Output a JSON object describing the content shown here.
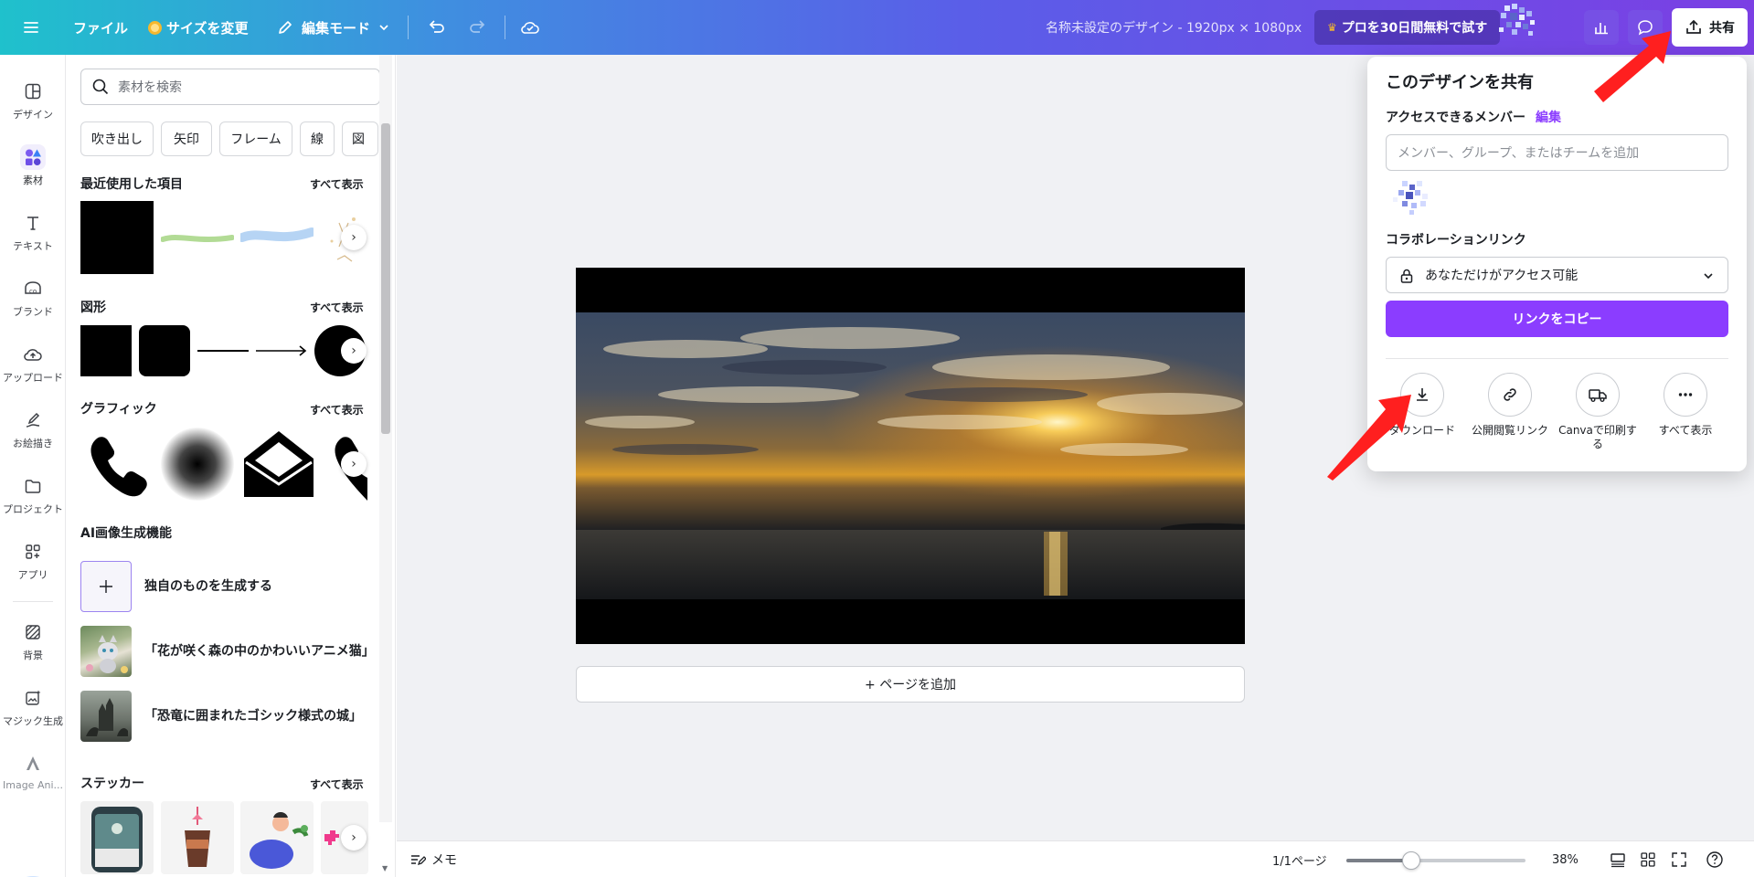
{
  "topbar": {
    "file": "ファイル",
    "resize": "サイズを変更",
    "edit_mode": "編集モード",
    "design_title": "名称未設定のデザイン - 1920px × 1080px",
    "pro_trial": "プロを30日間無料で試す",
    "share": "共有"
  },
  "rail": [
    {
      "label": "デザイン",
      "icon": "design-icon"
    },
    {
      "label": "素材",
      "icon": "elements-icon"
    },
    {
      "label": "テキスト",
      "icon": "text-icon"
    },
    {
      "label": "ブランド",
      "icon": "brand-icon"
    },
    {
      "label": "アップロード",
      "icon": "upload-icon"
    },
    {
      "label": "お絵描き",
      "icon": "draw-icon"
    },
    {
      "label": "プロジェクト",
      "icon": "folder-icon"
    },
    {
      "label": "アプリ",
      "icon": "apps-icon"
    },
    {
      "label": "背景",
      "icon": "background-icon"
    },
    {
      "label": "マジック生成",
      "icon": "magic-media-icon"
    },
    {
      "label": "Image Ani...",
      "icon": "image-animate-icon"
    }
  ],
  "panel": {
    "search_placeholder": "素材を検索",
    "chips": [
      "吹き出し",
      "矢印",
      "フレーム",
      "線",
      "図"
    ],
    "see_all": "すべて表示",
    "sections": {
      "recent": "最近使用した項目",
      "shapes": "図形",
      "graphics": "グラフィック",
      "ai": "AI画像生成機能",
      "stickers": "ステッカー"
    },
    "ai_items": [
      "独自のものを生成する",
      "「花が咲く森の中のかわいいアニメ猫」",
      "「恐竜に囲まれたゴシック様式の城」"
    ]
  },
  "canvas": {
    "add_page": "+ ページを追加"
  },
  "bottombar": {
    "notes": "メモ",
    "page_indicator": "1/1ページ",
    "zoom": "38%",
    "zoom_fraction": 0.38
  },
  "share_popup": {
    "title": "このデザインを共有",
    "access_members": "アクセスできるメンバー",
    "edit": "編集",
    "member_placeholder": "メンバー、グループ、またはチームを追加",
    "collab_link": "コラボレーションリンク",
    "access_level": "あなただけがアクセス可能",
    "copy_link": "リンクをコピー",
    "actions": [
      {
        "label": "ダウンロード",
        "icon": "download-icon"
      },
      {
        "label": "公開閲覧リンク",
        "icon": "link-icon"
      },
      {
        "label": "Canvaで印刷する",
        "icon": "print-truck-icon"
      },
      {
        "label": "すべて表示",
        "icon": "more-icon"
      }
    ]
  },
  "colors": {
    "accent": "#8b3dff",
    "topbar_start": "#1fc1cc",
    "topbar_end": "#7b3fe4",
    "annotation_arrow": "#ff1f1f"
  }
}
